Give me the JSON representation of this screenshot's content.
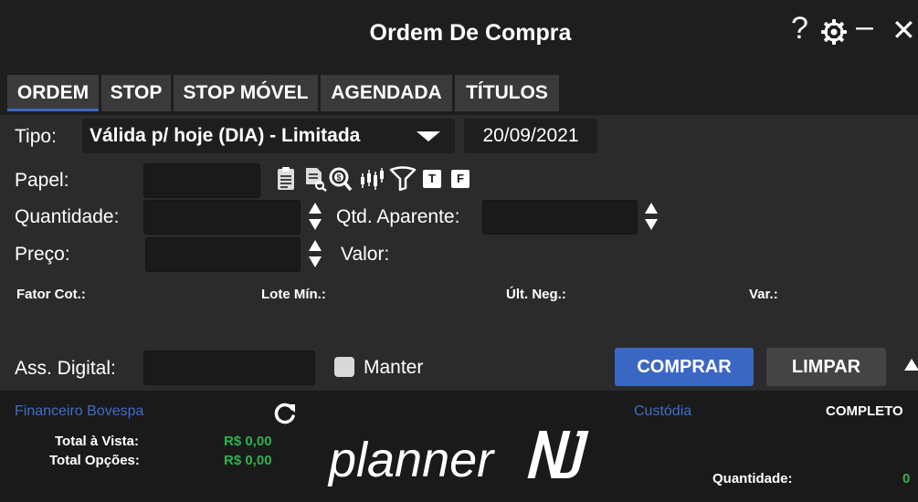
{
  "window": {
    "title": "Ordem De Compra",
    "help_glyph": "?",
    "minimize_glyph": "–",
    "close_glyph": "✕"
  },
  "tabs": [
    {
      "label": "ORDEM",
      "active": true
    },
    {
      "label": "STOP",
      "active": false
    },
    {
      "label": "STOP MÓVEL",
      "active": false
    },
    {
      "label": "AGENDADA",
      "active": false
    },
    {
      "label": "TÍTULOS",
      "active": false
    }
  ],
  "form": {
    "tipo_label": "Tipo:",
    "tipo_value": "Válida p/ hoje (DIA) - Limitada",
    "date": "20/09/2021",
    "papel_label": "Papel:",
    "papel_value": "",
    "quantidade_label": "Quantidade:",
    "quantidade_value": "",
    "qtd_aparente_label": "Qtd. Aparente:",
    "qtd_aparente_value": "",
    "preco_label": "Preço:",
    "preco_value": "",
    "valor_label": "Valor:",
    "fator_cot_label": "Fator Cot.:",
    "lote_min_label": "Lote Mín.:",
    "ult_neg_label": "Últ. Neg.:",
    "var_label": "Var.:",
    "ass_digital_label": "Ass. Digital:",
    "ass_digital_value": "",
    "manter_label": "Manter"
  },
  "papel_tools": {
    "t_label": "T",
    "f_label": "F"
  },
  "buttons": {
    "comprar": "COMPRAR",
    "limpar": "LIMPAR"
  },
  "footer": {
    "financeiro_link": "Financeiro Bovespa",
    "total_vista_label": "Total à Vista:",
    "total_vista_value": "R$ 0,00",
    "total_opcoes_label": "Total Opções:",
    "total_opcoes_value": "R$ 0,00",
    "custodia_link": "Custódia",
    "completo_label": "COMPLETO",
    "quantidade_label": "Quantidade:",
    "quantidade_value": "0",
    "logo_text": "planner"
  },
  "colors": {
    "accent": "#3b67c4",
    "positive": "#2fb24c",
    "link": "#3f6ec8",
    "background": "#2b2b2b"
  }
}
